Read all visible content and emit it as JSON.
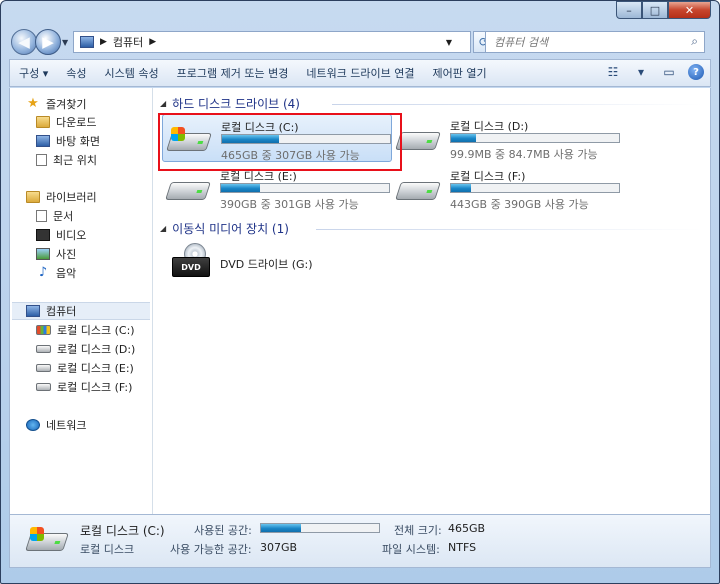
{
  "window": {
    "caption": {
      "minimize": "–",
      "maximize": "□",
      "close": "✕"
    }
  },
  "address_bar": {
    "crumb": "컴퓨터",
    "search_placeholder": "컴퓨터 검색"
  },
  "toolbar": {
    "items": [
      "구성 ▾",
      "속성",
      "시스템 속성",
      "프로그램 제거 또는 변경",
      "네트워크 드라이브 연결",
      "제어판 열기"
    ]
  },
  "sidebar": {
    "favorites": {
      "label": "즐겨찾기",
      "items": [
        "다운로드",
        "바탕 화면",
        "최근 위치"
      ]
    },
    "libraries": {
      "label": "라이브러리",
      "items": [
        "문서",
        "비디오",
        "사진",
        "음악"
      ]
    },
    "computer": {
      "label": "컴퓨터",
      "items": [
        "로컬 디스크 (C:)",
        "로컬 디스크 (D:)",
        "로컬 디스크 (E:)",
        "로컬 디스크 (F:)"
      ]
    },
    "network": {
      "label": "네트워크"
    }
  },
  "main": {
    "hard_disks_header": "하드 디스크 드라이브 (4)",
    "removable_header": "이동식 미디어 장치 (1)",
    "drives": [
      {
        "name": "로컬 디스크 (C:)",
        "free_text": "465GB 중 307GB 사용 가능",
        "used_fraction": 0.34
      },
      {
        "name": "로컬 디스크 (D:)",
        "free_text": "99.9MB 중 84.7MB 사용 가능",
        "used_fraction": 0.15
      },
      {
        "name": "로컬 디스크 (E:)",
        "free_text": "390GB 중 301GB 사용 가능",
        "used_fraction": 0.23
      },
      {
        "name": "로컬 디스크 (F:)",
        "free_text": "443GB 중 390GB 사용 가능",
        "used_fraction": 0.12
      }
    ],
    "dvd": {
      "name": "DVD 드라이브 (G:)",
      "label": "DVD"
    }
  },
  "details": {
    "title": "로컬 디스크 (C:)",
    "type": "로컬 디스크",
    "used_label": "사용된 공간:",
    "used_fraction": 0.34,
    "free_label": "사용 가능한 공간:",
    "free_value": "307GB",
    "total_label": "전체 크기:",
    "total_value": "465GB",
    "fs_label": "파일 시스템:",
    "fs_value": "NTFS"
  },
  "colors": {
    "highlight": "#e8101a",
    "bar_fill": "#1a86c7",
    "group_header": "#1e3287"
  }
}
